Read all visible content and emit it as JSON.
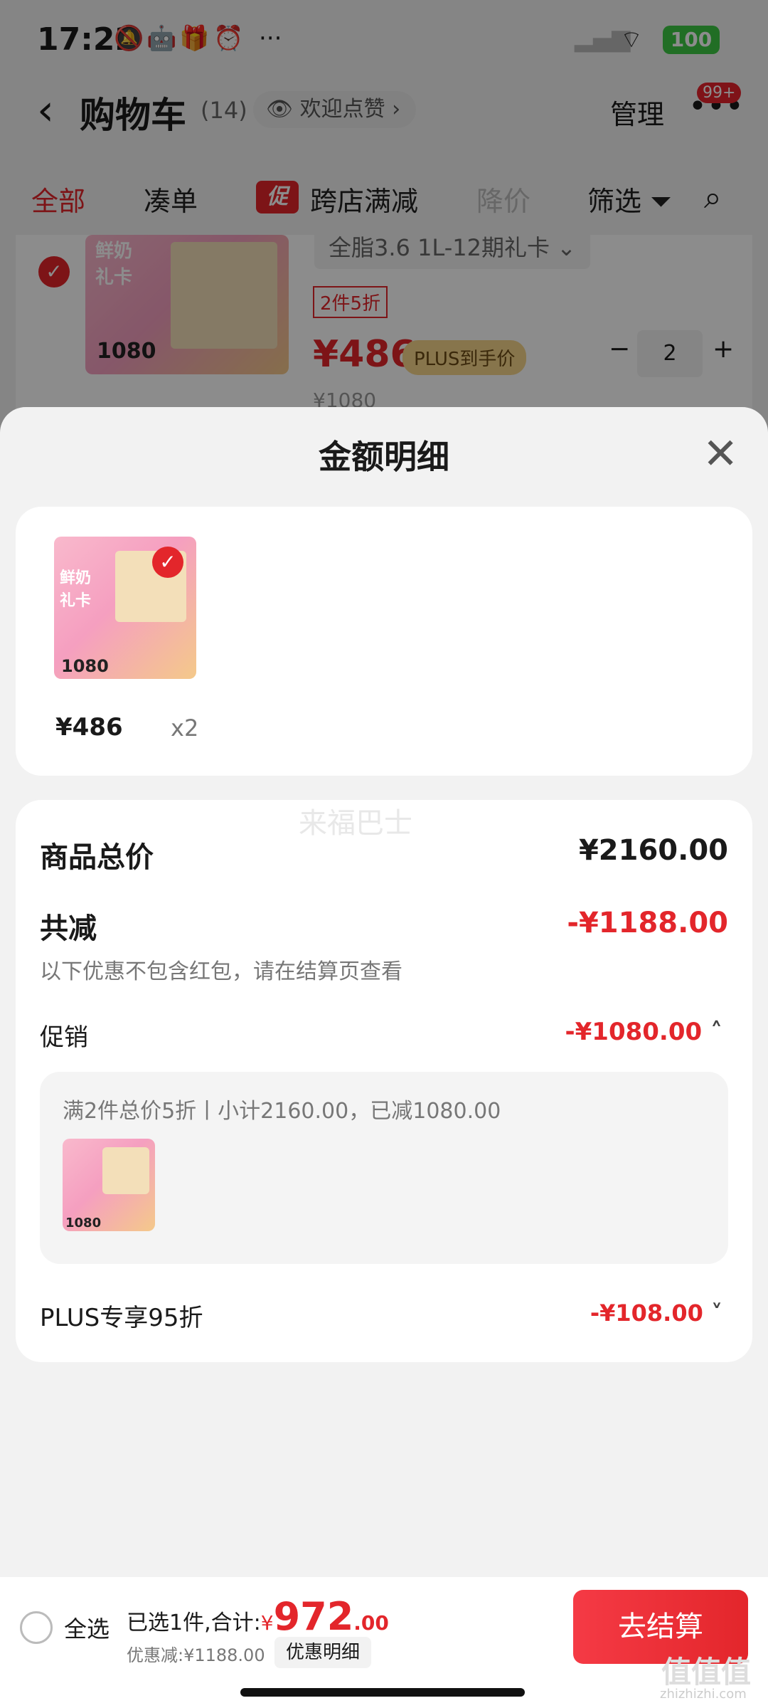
{
  "status_bar": {
    "time": "17:22",
    "battery": "100"
  },
  "header": {
    "back_icon": "chevron-left-icon",
    "title": "购物车",
    "count": "(14)",
    "like_label": "欢迎点赞 ›",
    "manage": "管理",
    "badge": "99+"
  },
  "tabs": [
    {
      "label": "全部",
      "active": true
    },
    {
      "label": "凑单"
    },
    {
      "label": "跨店满减",
      "prefix": "促"
    },
    {
      "label": "降价"
    },
    {
      "label": "筛选"
    }
  ],
  "cart_item": {
    "sku": "全脂3.6 1L-12期礼卡 ⌄",
    "discount_tag": "2件5折",
    "price": "¥486",
    "plus_label": "PLUS到手价",
    "quantity": "2",
    "original_price": "¥1080",
    "img_price": "1080",
    "img_text": "鲜奶 礼卡"
  },
  "sheet": {
    "title": "金额明细",
    "product": {
      "price": "¥486",
      "qty": "x2",
      "img_price": "1080",
      "img_text": "鲜奶 礼卡"
    },
    "watermark": "来福巴士",
    "total_label": "商品总价",
    "total_value": "¥2160.00",
    "reduced_label": "共减",
    "reduced_value": "-¥1188.00",
    "note": "以下优惠不包含红包，请在结算页查看",
    "promo_label": "促销",
    "promo_value": "-¥1080.00",
    "promo_detail": "满2件总价5折丨小计2160.00，已减1080.00",
    "promo_img_price": "1080",
    "plus_label": "PLUS专享95折",
    "plus_value": "-¥108.00"
  },
  "bottom_bar": {
    "select_all": "全选",
    "selected_text": "已选1件,合计:",
    "currency": "¥",
    "total_int": "972",
    "total_dec": ".00",
    "discount": "优惠减:¥1188.00",
    "detail_label": "优惠明细",
    "checkout": "去结算",
    "watermark": "值值值",
    "watermark_sub": "zhizhizhi.com"
  },
  "colors": {
    "accent": "#e3262b",
    "battery": "#3dc944",
    "plus": "#f6d68a"
  }
}
